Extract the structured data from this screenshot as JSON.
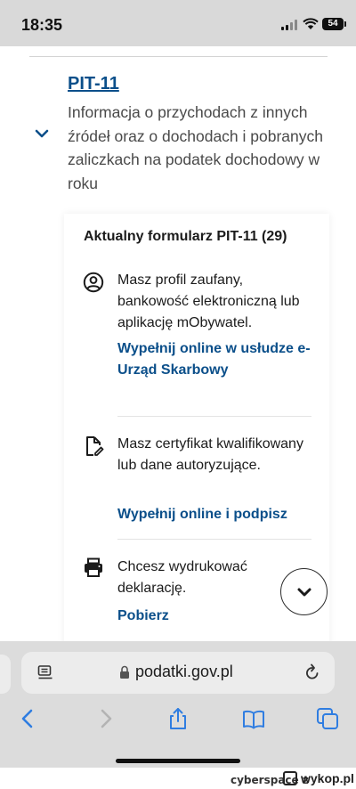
{
  "status_bar": {
    "time": "18:35",
    "battery": "54"
  },
  "content": {
    "form_link": "PIT-11",
    "form_description": "Informacja o przychodach z innych źródeł oraz o dochodach i pobranych zaliczkach na podatek dochodowy w roku",
    "card_title": "Aktualny formularz PIT-11 (29)",
    "options": [
      {
        "icon": "user-profile-icon",
        "text": "Masz profil zaufany, bankowość elektroniczną lub aplikację mObywatel.",
        "link": "Wypełnij online w usłudze e-Urząd Skarbowy"
      },
      {
        "icon": "document-sign-icon",
        "text": "Masz certyfikat kwalifikowany lub dane autoryzujące.",
        "link": "Wypełnij online i podpisz"
      },
      {
        "icon": "printer-icon",
        "text": "Chcesz wydrukować deklarację.",
        "link": "Pobierz"
      }
    ]
  },
  "browser": {
    "url": "podatki.gov.pl"
  },
  "footer": {
    "user": "cyberspace z",
    "site": "wykop.pl"
  }
}
